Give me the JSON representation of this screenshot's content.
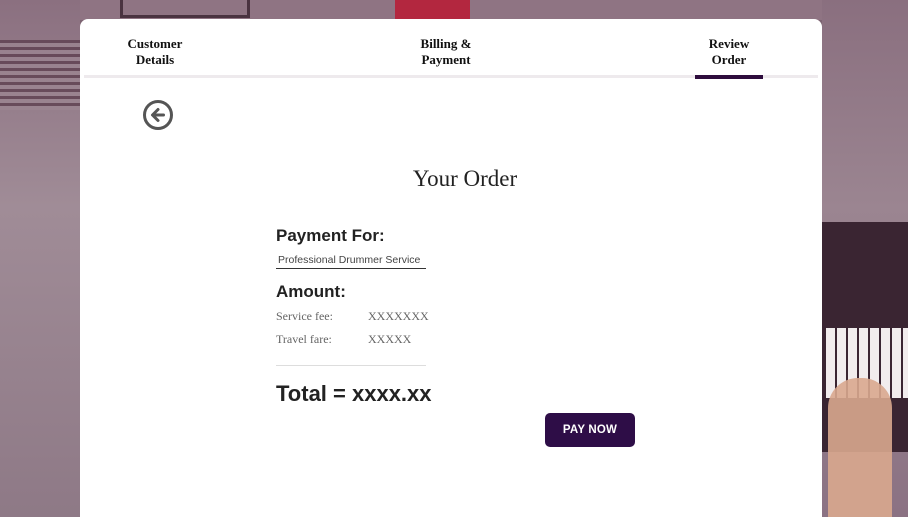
{
  "steps": [
    {
      "line1": "Customer",
      "line2": "Details",
      "active": false
    },
    {
      "line1": "Billing &",
      "line2": "Payment",
      "active": false
    },
    {
      "line1": "Review",
      "line2": "Order",
      "active": true
    }
  ],
  "back_icon": "arrow-left-circle-icon",
  "order": {
    "title": "Your Order",
    "payment_for_label": "Payment For:",
    "payment_for_value": "Professional Drummer Service",
    "amount_label": "Amount:",
    "fees": [
      {
        "label": "Service fee:",
        "value": "XXXXXXX"
      },
      {
        "label": "Travel fare:",
        "value": "XXXXX"
      }
    ],
    "total": "Total = xxxx.xx",
    "pay_button": "PAY NOW"
  },
  "colors": {
    "accent": "#2e0d47",
    "active_step_bar": "#2e0d3d",
    "card_background": "#ffffff"
  }
}
